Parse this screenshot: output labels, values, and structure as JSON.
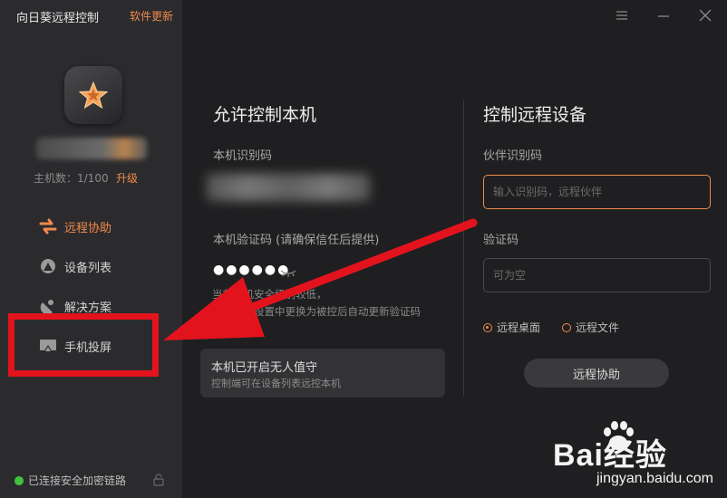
{
  "sidebar": {
    "app_title": "向日葵远程控制",
    "update_link": "软件更新",
    "host_count": "主机数：1/100",
    "upgrade": "升级",
    "items": [
      {
        "label": "远程协助",
        "icon": "remote-assist-icon",
        "active": true
      },
      {
        "label": "设备列表",
        "icon": "device-list-icon",
        "active": false
      },
      {
        "label": "解决方案",
        "icon": "solution-icon",
        "active": false
      },
      {
        "label": "手机投屏",
        "icon": "phone-cast-icon",
        "active": false
      }
    ],
    "status": "已连接安全加密链路"
  },
  "allow": {
    "title": "允许控制本机",
    "id_label": "本机识别码",
    "code_label": "本机验证码 (请确保信任后提供)",
    "password": "●●●●●●",
    "note_line1": "当前本机安全级别较低，",
    "note_line2": "建议您在设置中更换为被控后自动更新验证码",
    "card_title": "本机已开启无人值守",
    "card_sub": "控制端可在设备列表远控本机"
  },
  "control": {
    "title": "控制远程设备",
    "partner_label": "伙伴识别码",
    "partner_placeholder": "输入识别码，远程伙伴",
    "verify_label": "验证码",
    "verify_placeholder": "可为空",
    "radio_desktop": "远程桌面",
    "radio_file": "远程文件",
    "button": "远程协助"
  },
  "watermark": {
    "brand": "Bai经验",
    "url": "jingyan.baidu.com"
  },
  "colors": {
    "accent": "#f08a4b",
    "highlight": "#e3131d",
    "status_ok": "#3fc33f"
  }
}
